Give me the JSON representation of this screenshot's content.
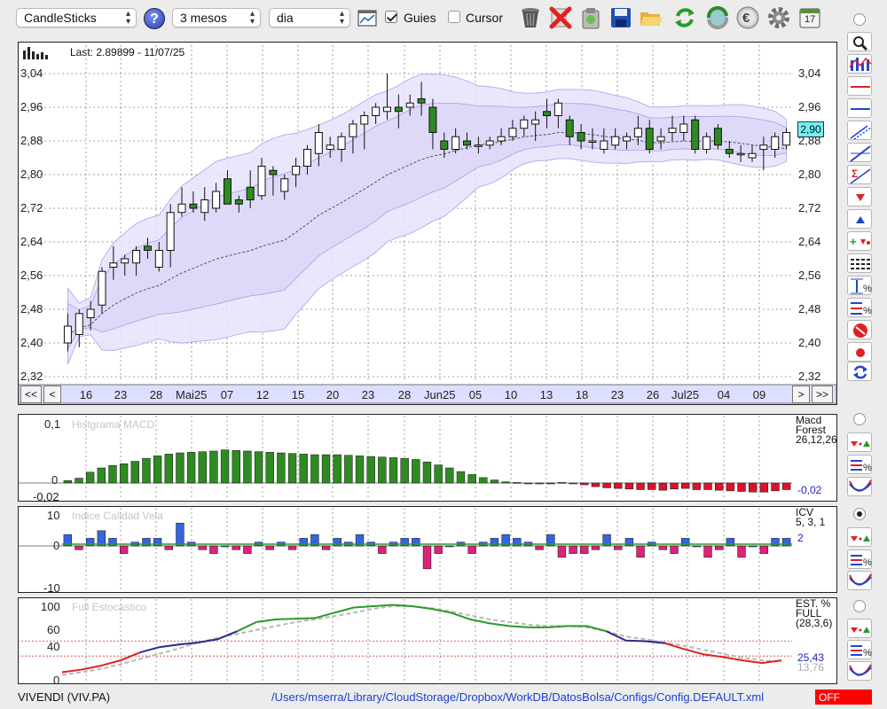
{
  "toolbar": {
    "chart_type": "CandleSticks",
    "period": "3 mesos",
    "interval": "dia",
    "guides_label": "Guies",
    "guides_checked": true,
    "cursor_label": "Cursor",
    "cursor_checked": false,
    "help_label": "?",
    "calendar_day": "17"
  },
  "main_chart": {
    "last_label": "Last: 2.89899 - 11/07/25",
    "current_value": "2,90",
    "y_labels": [
      "3,04",
      "2,96",
      "2,88",
      "2,80",
      "2,72",
      "2,64",
      "2,56",
      "2,48",
      "2,40",
      "2,32"
    ],
    "x_labels": [
      "16",
      "23",
      "28",
      "Mai25",
      "07",
      "12",
      "15",
      "20",
      "23",
      "28",
      "Jun25",
      "05",
      "10",
      "13",
      "18",
      "23",
      "26",
      "Jul25",
      "04",
      "09"
    ],
    "nav": {
      "first": "<<",
      "prev": "<",
      "next": ">",
      "last": ">>"
    }
  },
  "macd_panel": {
    "title": "Histgrama MACD",
    "y_labels": [
      "0,1",
      "0",
      "-0,02"
    ],
    "label_line1": "Macd",
    "label_line2": "Forest",
    "label_line3": "26,12,26",
    "value": "-0,02"
  },
  "icv_panel": {
    "title": "Indice Calidad Vela",
    "y_labels": [
      "10",
      "0",
      "-10"
    ],
    "label_line1": "ICV",
    "label_line2": "5, 3, 1",
    "value": "2"
  },
  "stoch_panel": {
    "title": "Full Estocastico",
    "y_labels": [
      "100",
      "60",
      "40",
      "0"
    ],
    "label_line1": "EST. %",
    "label_line2": "FULL",
    "label_line3": "(28,3,6)",
    "value1": "25,43",
    "value2": "13,76"
  },
  "status": {
    "symbol": "VIVENDI (VIV.PA)",
    "path": "/Users/mserra/Library/CloudStorage/Dropbox/WorkDB/DatosBolsa/Configs/Config.DEFAULT.xml",
    "mode": "OFF"
  },
  "colors": {
    "up": "#ffffff",
    "down": "#2e8b22",
    "band": "#e6e2fb",
    "macd_pos": "#2e8b22",
    "macd_neg": "#e0102a",
    "icv_pos": "#3366dd",
    "icv_neg": "#dd2277",
    "accent": "#1a3fd6",
    "off": "#ff0000"
  },
  "chart_data": [
    {
      "type": "candlestick",
      "title": "Last: 2.89899 - 11/07/25",
      "ylim": [
        2.32,
        3.08
      ],
      "xlabel": "",
      "ylabel": "",
      "x_tick_labels": [
        "16",
        "23",
        "28",
        "Mai25",
        "07",
        "12",
        "15",
        "20",
        "23",
        "28",
        "Jun25",
        "05",
        "10",
        "13",
        "18",
        "23",
        "26",
        "Jul25",
        "04",
        "09"
      ],
      "ohlc": [
        [
          2.4,
          2.47,
          2.38,
          2.44
        ],
        [
          2.42,
          2.48,
          2.39,
          2.47
        ],
        [
          2.46,
          2.5,
          2.43,
          2.48
        ],
        [
          2.49,
          2.58,
          2.47,
          2.57
        ],
        [
          2.58,
          2.63,
          2.55,
          2.59
        ],
        [
          2.59,
          2.61,
          2.56,
          2.6
        ],
        [
          2.59,
          2.63,
          2.56,
          2.62
        ],
        [
          2.63,
          2.65,
          2.6,
          2.62
        ],
        [
          2.58,
          2.64,
          2.57,
          2.62
        ],
        [
          2.62,
          2.73,
          2.58,
          2.71
        ],
        [
          2.71,
          2.77,
          2.7,
          2.73
        ],
        [
          2.73,
          2.76,
          2.71,
          2.72
        ],
        [
          2.71,
          2.77,
          2.69,
          2.74
        ],
        [
          2.72,
          2.78,
          2.71,
          2.76
        ],
        [
          2.79,
          2.81,
          2.73,
          2.73
        ],
        [
          2.74,
          2.75,
          2.71,
          2.73
        ],
        [
          2.77,
          2.81,
          2.72,
          2.74
        ],
        [
          2.75,
          2.84,
          2.74,
          2.82
        ],
        [
          2.81,
          2.82,
          2.75,
          2.8
        ],
        [
          2.76,
          2.8,
          2.74,
          2.79
        ],
        [
          2.8,
          2.84,
          2.77,
          2.82
        ],
        [
          2.82,
          2.87,
          2.8,
          2.86
        ],
        [
          2.85,
          2.92,
          2.82,
          2.9
        ],
        [
          2.86,
          2.89,
          2.84,
          2.87
        ],
        [
          2.86,
          2.9,
          2.83,
          2.89
        ],
        [
          2.89,
          2.93,
          2.85,
          2.92
        ],
        [
          2.92,
          2.95,
          2.86,
          2.94
        ],
        [
          2.94,
          2.97,
          2.92,
          2.96
        ],
        [
          2.95,
          3.04,
          2.93,
          2.96
        ],
        [
          2.96,
          2.99,
          2.91,
          2.95
        ],
        [
          2.96,
          2.99,
          2.94,
          2.97
        ],
        [
          2.98,
          3.02,
          2.94,
          2.97
        ],
        [
          2.96,
          2.98,
          2.86,
          2.9
        ],
        [
          2.88,
          2.9,
          2.84,
          2.86
        ],
        [
          2.86,
          2.91,
          2.85,
          2.89
        ],
        [
          2.88,
          2.9,
          2.86,
          2.87
        ],
        [
          2.87,
          2.89,
          2.85,
          2.87
        ],
        [
          2.87,
          2.89,
          2.86,
          2.88
        ],
        [
          2.88,
          2.91,
          2.87,
          2.89
        ],
        [
          2.89,
          2.93,
          2.88,
          2.91
        ],
        [
          2.91,
          2.94,
          2.89,
          2.93
        ],
        [
          2.92,
          2.95,
          2.88,
          2.93
        ],
        [
          2.95,
          2.98,
          2.91,
          2.94
        ],
        [
          2.94,
          2.98,
          2.91,
          2.97
        ],
        [
          2.93,
          2.94,
          2.87,
          2.89
        ],
        [
          2.9,
          2.92,
          2.86,
          2.88
        ],
        [
          2.88,
          2.91,
          2.86,
          2.88
        ],
        [
          2.86,
          2.91,
          2.85,
          2.88
        ],
        [
          2.87,
          2.91,
          2.86,
          2.89
        ],
        [
          2.88,
          2.9,
          2.86,
          2.89
        ],
        [
          2.89,
          2.94,
          2.87,
          2.91
        ],
        [
          2.91,
          2.93,
          2.85,
          2.86
        ],
        [
          2.88,
          2.91,
          2.86,
          2.89
        ],
        [
          2.9,
          2.94,
          2.88,
          2.91
        ],
        [
          2.9,
          2.94,
          2.88,
          2.92
        ],
        [
          2.93,
          2.94,
          2.85,
          2.86
        ],
        [
          2.86,
          2.9,
          2.85,
          2.89
        ],
        [
          2.91,
          2.92,
          2.86,
          2.87
        ],
        [
          2.86,
          2.88,
          2.84,
          2.85
        ],
        [
          2.85,
          2.87,
          2.83,
          2.85
        ],
        [
          2.84,
          2.87,
          2.83,
          2.85
        ],
        [
          2.86,
          2.89,
          2.81,
          2.87
        ],
        [
          2.86,
          2.9,
          2.84,
          2.89
        ],
        [
          2.87,
          2.91,
          2.86,
          2.9
        ]
      ]
    },
    {
      "type": "bar",
      "title": "Histgrama MACD",
      "ylim": [
        -0.02,
        0.1
      ],
      "values": [
        0.004,
        0.008,
        0.018,
        0.025,
        0.029,
        0.032,
        0.036,
        0.041,
        0.045,
        0.048,
        0.05,
        0.051,
        0.052,
        0.053,
        0.055,
        0.054,
        0.053,
        0.052,
        0.051,
        0.05,
        0.049,
        0.048,
        0.047,
        0.047,
        0.047,
        0.046,
        0.045,
        0.044,
        0.043,
        0.042,
        0.041,
        0.039,
        0.035,
        0.03,
        0.025,
        0.019,
        0.014,
        0.009,
        0.005,
        0.002,
        0.001,
        0,
        -0.001,
        -0.001,
        0.001,
        0,
        -0.003,
        -0.006,
        -0.008,
        -0.009,
        -0.01,
        -0.011,
        -0.011,
        -0.012,
        -0.01,
        -0.009,
        -0.011,
        -0.011,
        -0.012,
        -0.013,
        -0.014,
        -0.015,
        -0.015,
        -0.013,
        -0.011
      ]
    },
    {
      "type": "bar",
      "title": "Indice Calidad Vela",
      "ylim": [
        -10,
        10
      ],
      "values": [
        3,
        -1,
        2,
        4,
        2,
        -2,
        1,
        2,
        2,
        -1,
        6,
        1,
        -1,
        -2,
        0,
        -1,
        -2,
        1,
        -1,
        1,
        -1,
        2,
        3,
        -1,
        2,
        1,
        3,
        1,
        -2,
        1,
        2,
        2,
        -6,
        -2,
        0,
        1,
        -2,
        1,
        2,
        3,
        2,
        1,
        -1,
        3,
        -3,
        -2,
        -2,
        -1,
        3,
        -1,
        2,
        -3,
        1,
        -1,
        -2,
        2,
        0,
        -3,
        -1,
        2,
        -3,
        0,
        -2,
        2,
        2
      ]
    },
    {
      "type": "line",
      "title": "Full Estocastico",
      "ylim": [
        0,
        100
      ],
      "series": [
        {
          "values": [
            10,
            14,
            20,
            28,
            40,
            48,
            52,
            55,
            60,
            72,
            86,
            90,
            91,
            92,
            100,
            108,
            110,
            112,
            110,
            106,
            100,
            90,
            84,
            80,
            78,
            78,
            80,
            80,
            72,
            58,
            57,
            54,
            45,
            37,
            33,
            28,
            24,
            28
          ]
        },
        {
          "values": [
            6,
            10,
            15,
            22,
            30,
            38,
            46,
            55,
            62,
            68,
            74,
            80,
            86,
            90,
            95,
            100,
            106,
            110,
            110,
            107,
            102,
            96,
            90,
            86,
            82,
            80,
            80,
            78,
            72,
            64,
            60,
            55,
            50,
            44,
            38,
            32,
            28,
            26
          ]
        }
      ]
    }
  ]
}
